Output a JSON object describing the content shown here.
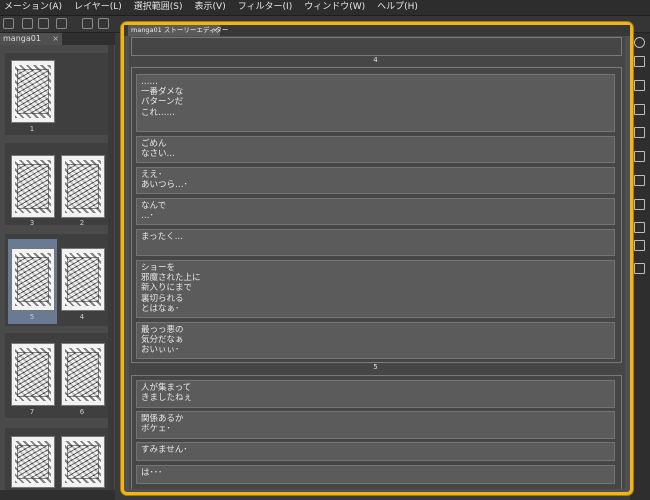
{
  "menu": [
    "メーション(A)",
    "レイヤー(L)",
    "選択範囲(S)",
    "表示(V)",
    "フィルター(I)",
    "ウィンドウ(W)",
    "ヘルプ(H)"
  ],
  "page_manager": {
    "tab_label": "manga01",
    "tab_close": "×",
    "pages": [
      {
        "number": "1"
      },
      {
        "number": "3"
      },
      {
        "number": "2"
      },
      {
        "number": "5"
      },
      {
        "number": "4"
      },
      {
        "number": "7"
      },
      {
        "number": "6"
      }
    ]
  },
  "story_editor": {
    "tab_label": "manga01 ストーリーエディター",
    "tab_close": "×",
    "top_page_label": "4",
    "sections": [
      {
        "boxes": [
          "……\n一番ダメな\nパターンだ\nこれ……",
          "ごめん\nなさい…",
          "ええ･\nあいつら…･",
          "なんで\n…･",
          "まったく…",
          "ショーを\n邪魔された上に\n新入りにまで\n裏切られる\nとはなぁ･",
          "最っっ悪の\n気分だなぁ\nおいぃぃ･"
        ],
        "page_label": "5"
      },
      {
        "boxes": [
          "人が集まって\nきましたねぇ",
          "関係あるか\nボケェ･",
          "すみません･",
          "は･･･"
        ]
      }
    ]
  }
}
